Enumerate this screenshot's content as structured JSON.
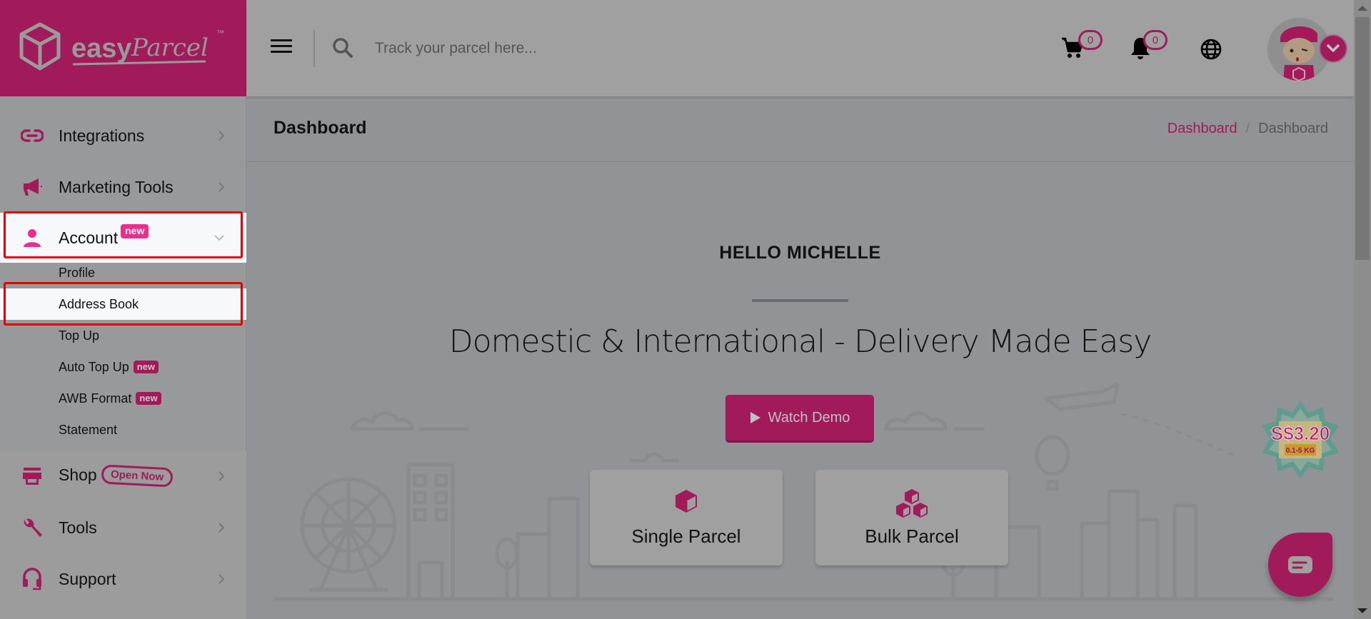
{
  "brand": {
    "name_bold": "easy",
    "name_script": "Parcel",
    "trademark": "™",
    "accent_color": "#a11a5a",
    "highlight_color": "#e60000"
  },
  "header": {
    "search_placeholder": "Track your parcel here...",
    "cart_count": "0",
    "notification_count": "0",
    "icons": [
      "menu-icon",
      "search-icon",
      "cart-icon",
      "bell-icon",
      "globe-icon",
      "avatar",
      "chevron-down-icon"
    ]
  },
  "sidebar": {
    "items": [
      {
        "label": "Integrations",
        "icon": "link-icon"
      },
      {
        "label": "Marketing Tools",
        "icon": "megaphone-icon"
      },
      {
        "label": "Account",
        "icon": "user-icon",
        "badge": "new",
        "expanded": true
      },
      {
        "label": "Shop",
        "icon": "store-icon",
        "badge": "Open Now"
      },
      {
        "label": "Tools",
        "icon": "wrench-icon"
      },
      {
        "label": "Support",
        "icon": "headset-icon"
      }
    ],
    "account_submenu": [
      {
        "label": "Profile"
      },
      {
        "label": "Address Book",
        "active": true
      },
      {
        "label": "Top Up"
      },
      {
        "label": "Auto Top Up",
        "badge": "new"
      },
      {
        "label": "AWB Format",
        "badge": "new"
      },
      {
        "label": "Statement"
      }
    ]
  },
  "page": {
    "title": "Dashboard",
    "breadcrumb": [
      {
        "label": "Dashboard",
        "link": true
      },
      {
        "label": "Dashboard",
        "link": false
      }
    ],
    "breadcrumb_separator": "/"
  },
  "hero": {
    "greeting": "HELLO MICHELLE",
    "tagline": "Domestic & International - Delivery Made Easy",
    "watch_demo_label": "Watch Demo",
    "cards": [
      {
        "label": "Single Parcel",
        "icon": "box-icon"
      },
      {
        "label": "Bulk Parcel",
        "icon": "boxes-icon"
      }
    ]
  },
  "promo": {
    "price": "S$3.20",
    "weight": "0.1-5 KG"
  }
}
